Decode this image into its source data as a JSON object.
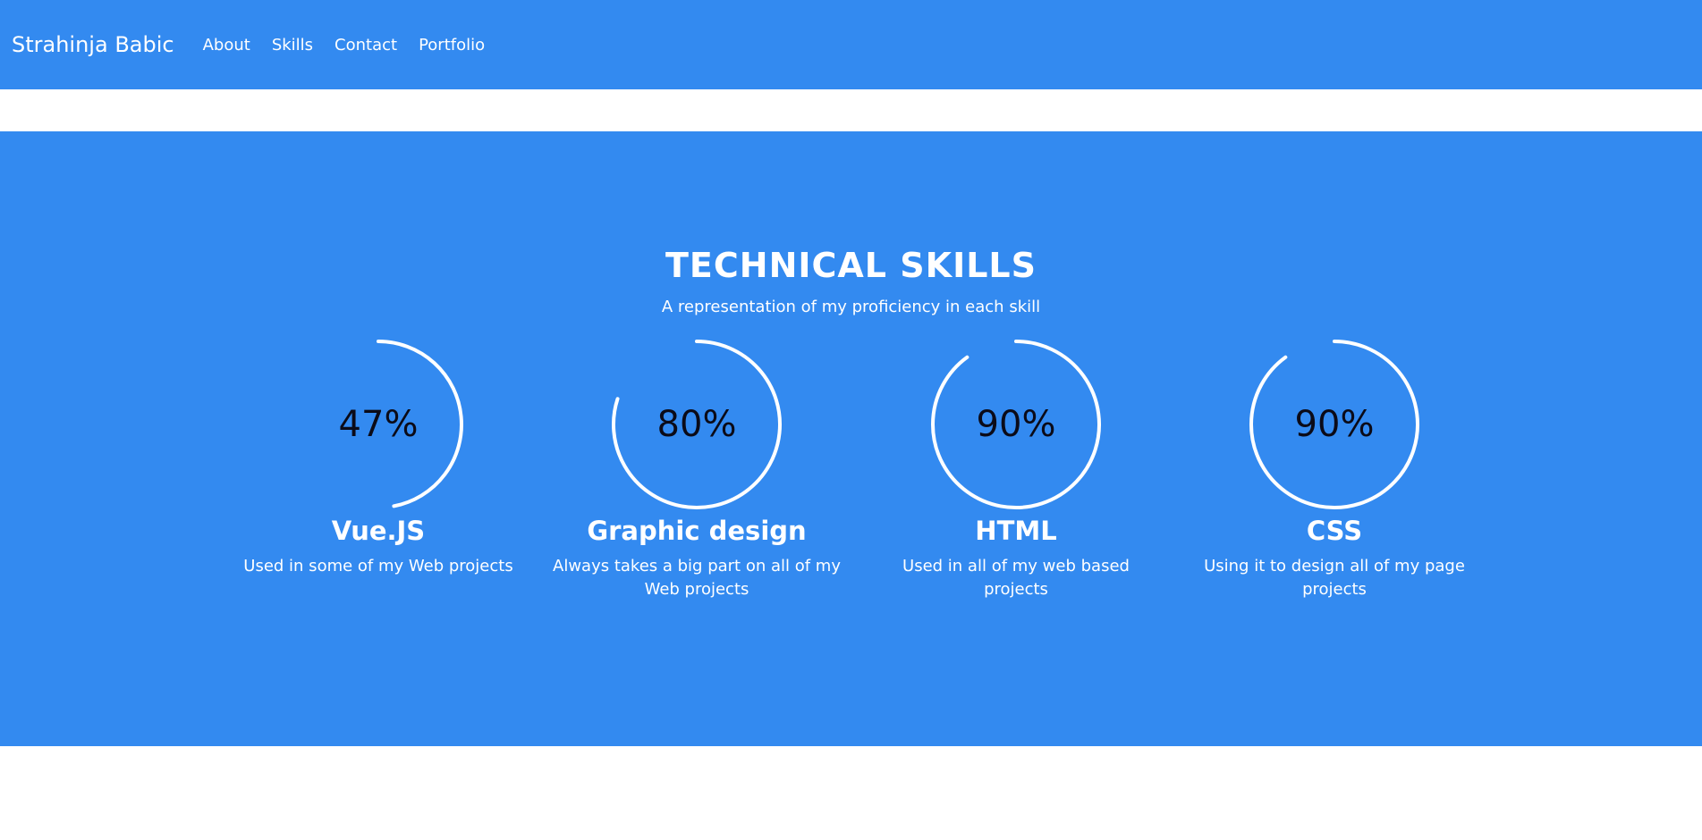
{
  "navbar": {
    "brand": "Strahinja Babic",
    "links": [
      "About",
      "Skills",
      "Contact",
      "Portfolio"
    ]
  },
  "skills_section": {
    "title": "TECHNICAL SKILLS",
    "subtitle": "A representation of my proficiency in each skill",
    "items": [
      {
        "percent": 47,
        "label": "47%",
        "name": "Vue.JS",
        "description": "Used in some of my Web projects"
      },
      {
        "percent": 80,
        "label": "80%",
        "name": "Graphic design",
        "description": "Always takes a big part on all of my Web projects"
      },
      {
        "percent": 90,
        "label": "90%",
        "name": "HTML",
        "description": "Used in all of my web based projects"
      },
      {
        "percent": 90,
        "label": "90%",
        "name": "CSS",
        "description": "Using it to design all of my page projects"
      }
    ]
  },
  "colors": {
    "primary": "#338af0",
    "arc": "#ffffff",
    "percent_text": "#0b0b18"
  }
}
